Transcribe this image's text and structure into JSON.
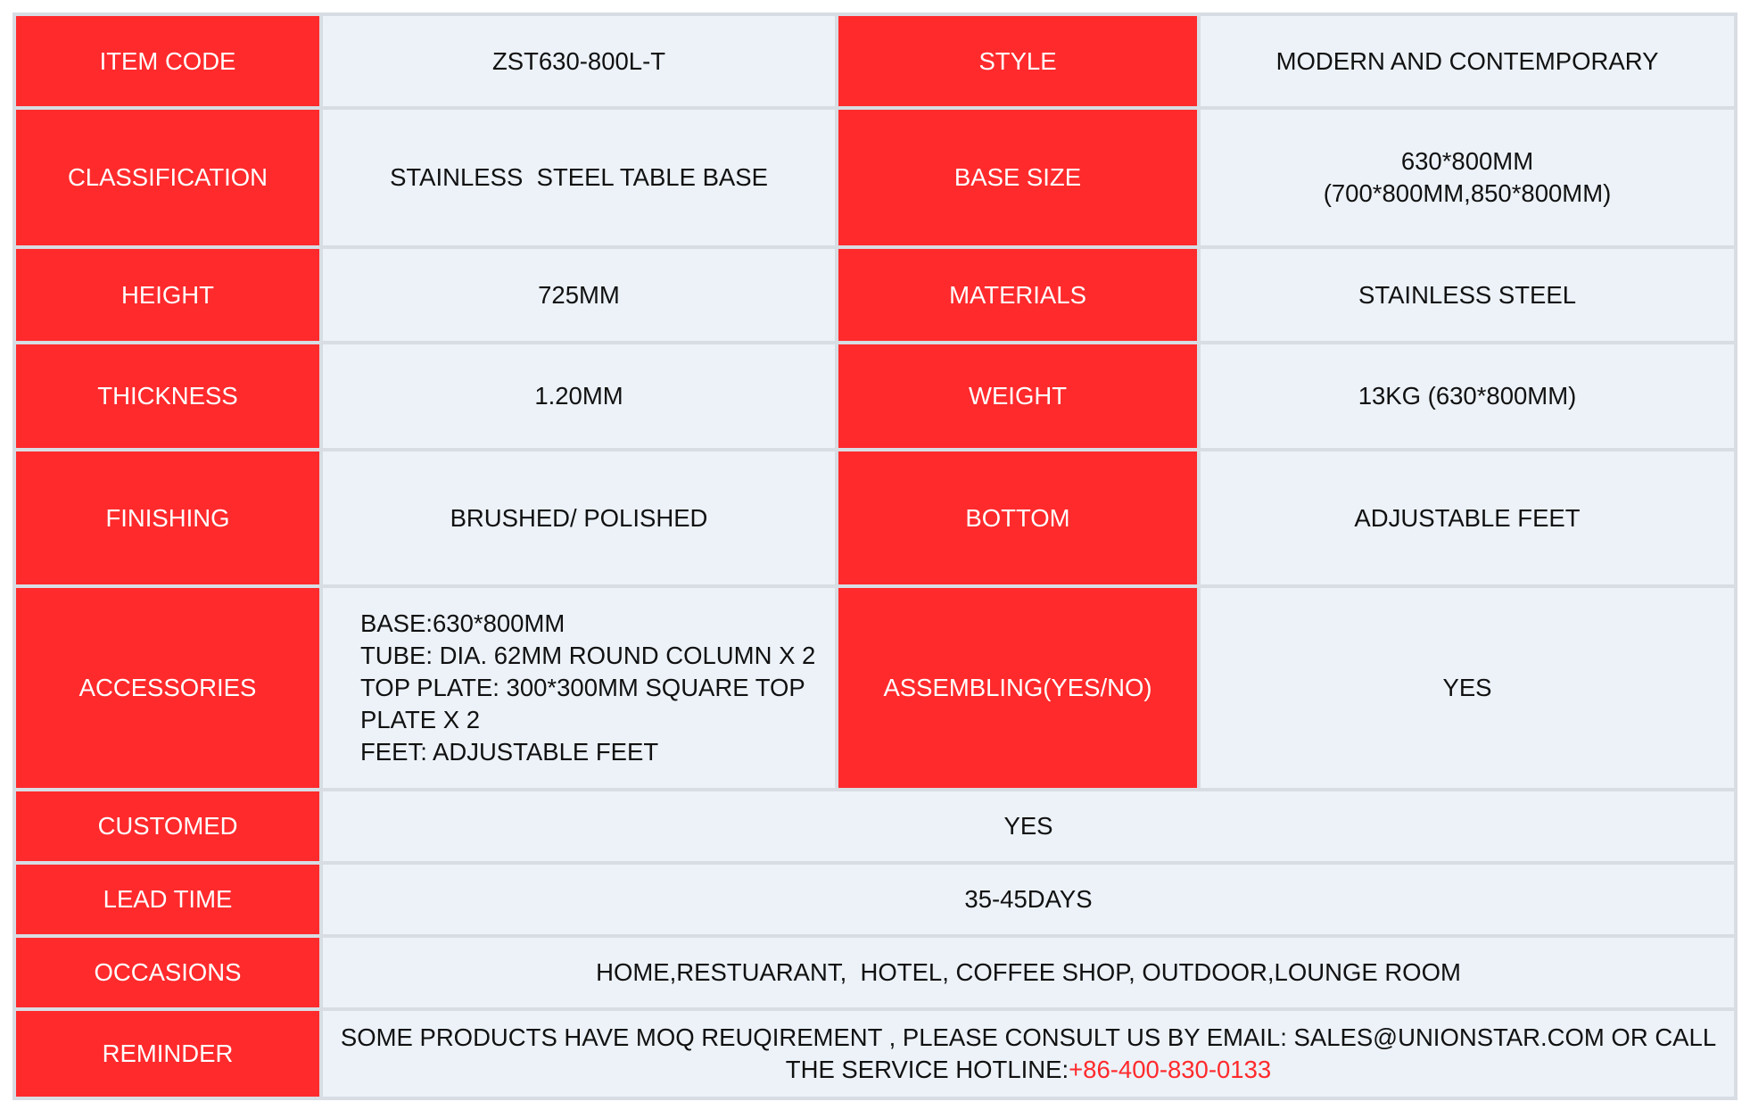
{
  "colors": {
    "label_bg": "#ff2a2c",
    "label_text": "#ffffff",
    "value_bg": "#ecf2f8",
    "hotline": "#ff2a2c"
  },
  "item_code": {
    "label": "ITEM CODE",
    "value": "ZST630-800L-T"
  },
  "style": {
    "label": "STYLE",
    "value": "MODERN AND CONTEMPORARY"
  },
  "classification": {
    "label": "CLASSIFICATION",
    "value": "STAINLESS  STEEL TABLE BASE"
  },
  "base_size": {
    "label": "BASE SIZE",
    "lines": [
      "630*800MM",
      "(700*800MM,850*800MM)"
    ]
  },
  "height": {
    "label": "HEIGHT",
    "value": "725MM"
  },
  "materials": {
    "label": "MATERIALS",
    "value": "STAINLESS STEEL"
  },
  "thickness": {
    "label": "THICKNESS",
    "value": "1.20MM"
  },
  "weight": {
    "label": "WEIGHT",
    "value": "13KG (630*800MM)"
  },
  "finishing": {
    "label": "FINISHING",
    "value": "BRUSHED/ POLISHED"
  },
  "bottom": {
    "label": "BOTTOM",
    "value": "ADJUSTABLE FEET"
  },
  "accessories": {
    "label": "ACCESSORIES",
    "lines": [
      "BASE:630*800MM",
      "TUBE: DIA. 62MM ROUND COLUMN X 2",
      "TOP PLATE: 300*300MM SQUARE TOP",
      "PLATE X 2",
      "FEET: ADJUSTABLE FEET"
    ]
  },
  "assembling": {
    "label": "ASSEMBLING(YES/NO)",
    "value": "YES"
  },
  "customed": {
    "label": "CUSTOMED",
    "value": "YES"
  },
  "lead_time": {
    "label": "LEAD TIME",
    "value": "35-45DAYS"
  },
  "occasions": {
    "label": "OCCASIONS",
    "value": "HOME,RESTUARANT,  HOTEL, COFFEE SHOP, OUTDOOR,LOUNGE ROOM"
  },
  "reminder": {
    "label": "REMINDER",
    "line1": "SOME PRODUCTS HAVE MOQ REUQIREMENT , PLEASE CONSULT US BY EMAIL: SALES@UNIONSTAR.COM OR CALL",
    "line2_prefix": "THE SERVICE HOTLINE:",
    "hotline": "+86-400-830-0133"
  }
}
